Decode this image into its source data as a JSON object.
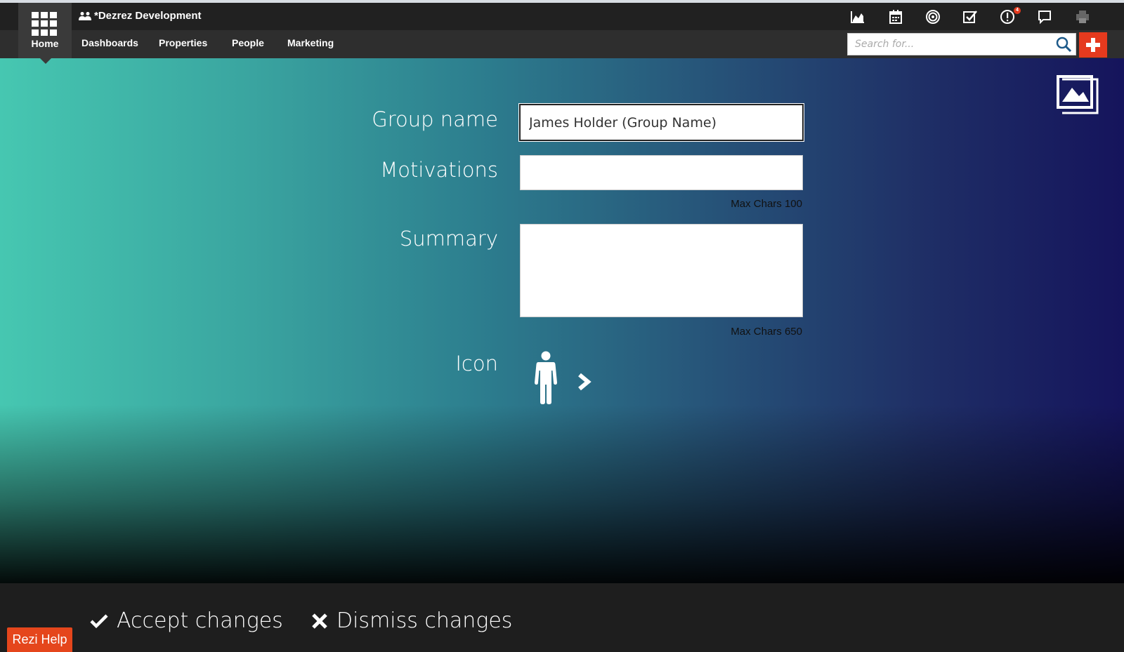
{
  "header": {
    "app_title": "*Dezrez Development",
    "home_label": "Home",
    "nav": [
      {
        "label": "Dashboards"
      },
      {
        "label": "Properties"
      },
      {
        "label": "People"
      },
      {
        "label": "Marketing"
      }
    ],
    "icons": [
      "chart-icon",
      "calendar-icon",
      "target-icon",
      "tasks-icon",
      "alert-icon",
      "chat-icon",
      "print-icon"
    ],
    "alert_badge": "4",
    "search": {
      "placeholder": "Search for...",
      "value": ""
    }
  },
  "form": {
    "group_name": {
      "label": "Group name",
      "value": "James Holder (Group Name)"
    },
    "motivations": {
      "label": "Motivations",
      "value": "",
      "hint": "Max Chars 100"
    },
    "summary": {
      "label": "Summary",
      "value": "",
      "hint": "Max Chars 650"
    },
    "icon": {
      "label": "Icon"
    }
  },
  "footer": {
    "accept_label": "Accept changes",
    "dismiss_label": "Dismiss changes",
    "help_label": "Rezi Help"
  },
  "colors": {
    "accent": "#e53a1e",
    "topbar": "#212121",
    "navbar": "#2e2e2e",
    "gradient_left": "#46c7b1",
    "gradient_right": "#15145c"
  }
}
